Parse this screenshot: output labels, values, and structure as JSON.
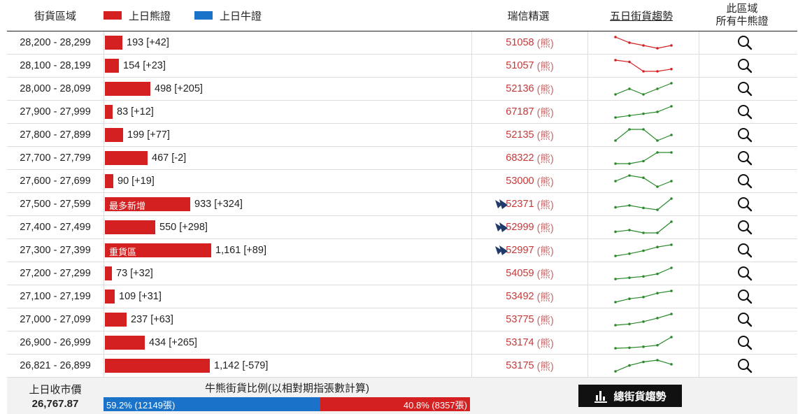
{
  "header": {
    "range_label": "街貨區域",
    "bear_legend": "上日熊證",
    "bull_legend": "上日牛證",
    "ubs_label": "瑞信精選",
    "trend_label": "五日街貨趨勢",
    "search_label_1": "此區域",
    "search_label_2": "所有牛熊證"
  },
  "colors": {
    "bear": "#d42020",
    "bull": "#1a73c8",
    "trend_down": "#d42020",
    "trend_up": "#2a8a2a"
  },
  "bar_scale_max": 1161,
  "rows": [
    {
      "range": "28,200 - 28,299",
      "count": 193,
      "value_text": "193 [+42]",
      "tag": "",
      "code": "51058",
      "bear": "(熊)",
      "ubs_logo": false,
      "trend": [
        4,
        2,
        1,
        0,
        1
      ],
      "trend_color": "#d42020"
    },
    {
      "range": "28,100 - 28,199",
      "count": 154,
      "value_text": "154 [+23]",
      "tag": "",
      "code": "51057",
      "bear": "(熊)",
      "ubs_logo": false,
      "trend": [
        4,
        3.6,
        1.5,
        1.5,
        2
      ],
      "trend_color": "#d42020"
    },
    {
      "range": "28,000 - 28,099",
      "count": 498,
      "value_text": "498 [+205]",
      "tag": "",
      "code": "52136",
      "bear": "(熊)",
      "ubs_logo": false,
      "trend": [
        1,
        2,
        1,
        2,
        3
      ],
      "trend_color": "#2a8a2a"
    },
    {
      "range": "27,900 - 27,999",
      "count": 83,
      "value_text": "83 [+12]",
      "tag": "",
      "code": "67187",
      "bear": "(熊)",
      "ubs_logo": false,
      "trend": [
        0,
        0.3,
        0.6,
        0.9,
        1.8
      ],
      "trend_color": "#2a8a2a"
    },
    {
      "range": "27,800 - 27,899",
      "count": 199,
      "value_text": "199 [+77]",
      "tag": "",
      "code": "52135",
      "bear": "(熊)",
      "ubs_logo": false,
      "trend": [
        1,
        3,
        3,
        1,
        2
      ],
      "trend_color": "#2a8a2a"
    },
    {
      "range": "27,700 - 27,799",
      "count": 467,
      "value_text": "467 [-2]",
      "tag": "",
      "code": "68322",
      "bear": "(熊)",
      "ubs_logo": false,
      "trend": [
        0,
        0,
        0.5,
        2.2,
        2.2
      ],
      "trend_color": "#2a8a2a"
    },
    {
      "range": "27,600 - 27,699",
      "count": 90,
      "value_text": "90 [+19]",
      "tag": "",
      "code": "53000",
      "bear": "(熊)",
      "ubs_logo": false,
      "trend": [
        2,
        3,
        2.6,
        1,
        2
      ],
      "trend_color": "#2a8a2a"
    },
    {
      "range": "27,500 - 27,599",
      "count": 933,
      "value_text": "933 [+324]",
      "tag": "最多新增",
      "code": "52371",
      "bear": "(熊)",
      "ubs_logo": true,
      "trend": [
        1,
        1.3,
        0.9,
        0.6,
        2.4
      ],
      "trend_color": "#2a8a2a"
    },
    {
      "range": "27,400 - 27,499",
      "count": 550,
      "value_text": "550 [+298]",
      "tag": "",
      "code": "52999",
      "bear": "(熊)",
      "ubs_logo": true,
      "trend": [
        1,
        1.3,
        0.8,
        0.8,
        2.8
      ],
      "trend_color": "#2a8a2a"
    },
    {
      "range": "27,300 - 27,399",
      "count": 1161,
      "value_text": "1,161 [+89]",
      "tag": "重貨區",
      "code": "52997",
      "bear": "(熊)",
      "ubs_logo": true,
      "trend": [
        0,
        0.3,
        0.7,
        1.2,
        1.5
      ],
      "trend_color": "#2a8a2a"
    },
    {
      "range": "27,200 - 27,299",
      "count": 73,
      "value_text": "73 [+32]",
      "tag": "",
      "code": "54059",
      "bear": "(熊)",
      "ubs_logo": false,
      "trend": [
        0,
        0.3,
        0.6,
        1.2,
        2.6
      ],
      "trend_color": "#2a8a2a"
    },
    {
      "range": "27,100 - 27,199",
      "count": 109,
      "value_text": "109 [+31]",
      "tag": "",
      "code": "53492",
      "bear": "(熊)",
      "ubs_logo": false,
      "trend": [
        0,
        0.6,
        0.9,
        1.6,
        2
      ],
      "trend_color": "#2a8a2a"
    },
    {
      "range": "27,000 - 27,099",
      "count": 237,
      "value_text": "237 [+63]",
      "tag": "",
      "code": "53775",
      "bear": "(熊)",
      "ubs_logo": false,
      "trend": [
        0,
        0.2,
        0.6,
        1.2,
        1.9
      ],
      "trend_color": "#2a8a2a"
    },
    {
      "range": "26,900 - 26,999",
      "count": 434,
      "value_text": "434 [+265]",
      "tag": "",
      "code": "53174",
      "bear": "(熊)",
      "ubs_logo": false,
      "trend": [
        0,
        0.1,
        0.3,
        0.6,
        2.2
      ],
      "trend_color": "#2a8a2a"
    },
    {
      "range": "26,821 - 26,899",
      "count": 1142,
      "value_text": "1,142 [-579]",
      "tag": "",
      "code": "53175",
      "bear": "(熊)",
      "ubs_logo": false,
      "trend": [
        0,
        1,
        1.6,
        1.9,
        1.2
      ],
      "trend_color": "#2a8a2a"
    }
  ],
  "footer": {
    "close_label": "上日收市價",
    "close_value": "26,767.87",
    "ratio_title": "牛熊街貨比例(以相對期指張數計算)",
    "bull_pct": 59.2,
    "bull_text": "59.2% (12149張)",
    "bear_text": "40.8% (8357張)",
    "total_button": "總街貨趨勢"
  }
}
